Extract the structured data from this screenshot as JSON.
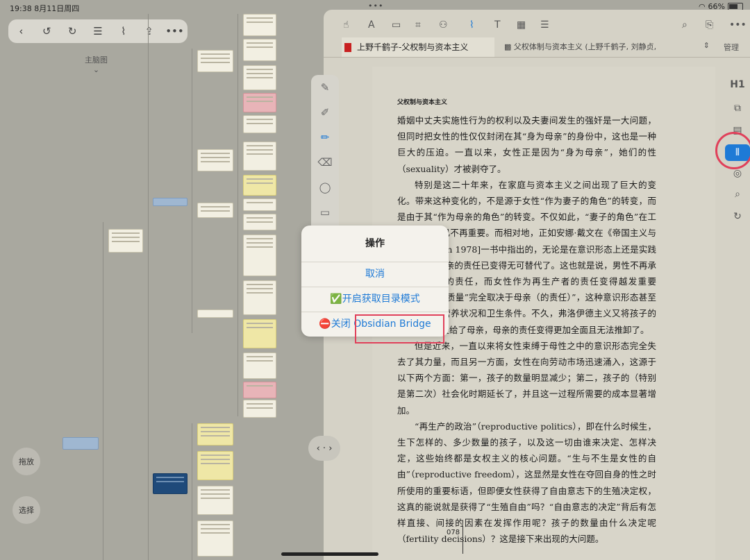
{
  "status": {
    "time": "19:38",
    "date": "8月11日周四",
    "dots": "•••",
    "battery": "66%",
    "battery_level": 0.66
  },
  "left": {
    "toolbar": [
      "‹",
      "↺",
      "↻",
      "☰",
      "⌇",
      "⇪",
      "•••"
    ],
    "brain_label": "主脑图",
    "brain_chevron": "⌄",
    "btn_drag": "拖放",
    "btn_select": "选择",
    "collapse_label": "‹ · ›"
  },
  "annobar_icons": [
    "✎",
    "✐",
    "✏",
    "⌫",
    "◯",
    "▭",
    "•••"
  ],
  "right": {
    "toolbar_icons": [
      "☝",
      "A",
      "▭",
      "⌗",
      "⚇",
      "⌇",
      "T",
      "▦",
      "☰",
      "⌕",
      "⎘",
      "•••"
    ],
    "tab1": "上野千鹤子-父权制与资本主义",
    "tab2": "父权体制与资本主义 (上野千鹤子, 刘静贞,...",
    "tab_arrow": "⇕",
    "tab_manage": "管理",
    "side_icons": [
      "H1",
      "⧉",
      "▤",
      "⦀",
      "◎",
      "⌕",
      "↻"
    ],
    "page_title": "父权制与资本主义",
    "page_number": "078",
    "paragraphs": [
      "婚姻中丈夫实施性行为的权利以及夫妻间发生的强奸是一大问题，但同时把女性的性仅仅封闭在其“身为母亲”的身份中，这也是一种巨大的压迫。一直以来，女性正是因为“身为母亲”，她们的性（sexuality）才被剥夺了。",
      "特别是这二十年来，在家庭与资本主义之间出现了巨大的变化。带来这种变化的，不是源于女性“作为妻子的角色”的转变，而是由于其“作为母亲的角色”的转变。不仅如此，“妻子的角色”在工业化初期就已不再重要。而相对地，正如安娜·戴文在《帝国主义与母性》[Davin 1978]一书中指出的，无论是在意识形态上还是实践上，“作为母亲的责任已变得无可替代了。这也就是说，男性不再承担作为父亲的责任，而女性作为再生产者的责任变得越发重要了。“孩子的质量”完全取决于母亲（的责任）”，这种意识形态甚至包括孩子的营养状况和卫生条件。不久，弗洛伊德主义又将孩子的精神卫生也交给了母亲，母亲的责任变得更加全面且无法推卸了。",
      "但是近来，一直以来将女性束缚于母性之中的意识形态完全失去了其力量，而且另一方面，女性在向劳动市场迅速涌入，这源于以下两个方面：第一，孩子的数量明显减少；第二，孩子的（特别是第二次）社会化时期延长了，并且这一过程所需要的成本显著增加。",
      "“再生产的政治”（reproductive politics），即在什么时候生，生下怎样的、多少数量的孩子，以及这一切由谁来决定、怎样决定，这些始终都是女权主义的核心问题。“生与不生是女性的自由”（reproductive freedom），这显然是女性在夺回自身的性之时所使用的重要标语，但即便女性获得了自由意志下的生殖决定权，这真的能说就是获得了“生殖自由”吗？“自由意志的决定”背后有怎样直接、间接的因素在发挥作用呢？孩子的数量由什么决定呢（fertility decisions）？这是接下来出现的大问题。"
    ]
  },
  "dialog": {
    "title": "操作",
    "cancel": "取消",
    "enable_icon": "✅",
    "enable_toc": "开启获取目录模式",
    "close_icon": "⛔",
    "close_bridge": "关闭 Obsidian Bridge"
  }
}
